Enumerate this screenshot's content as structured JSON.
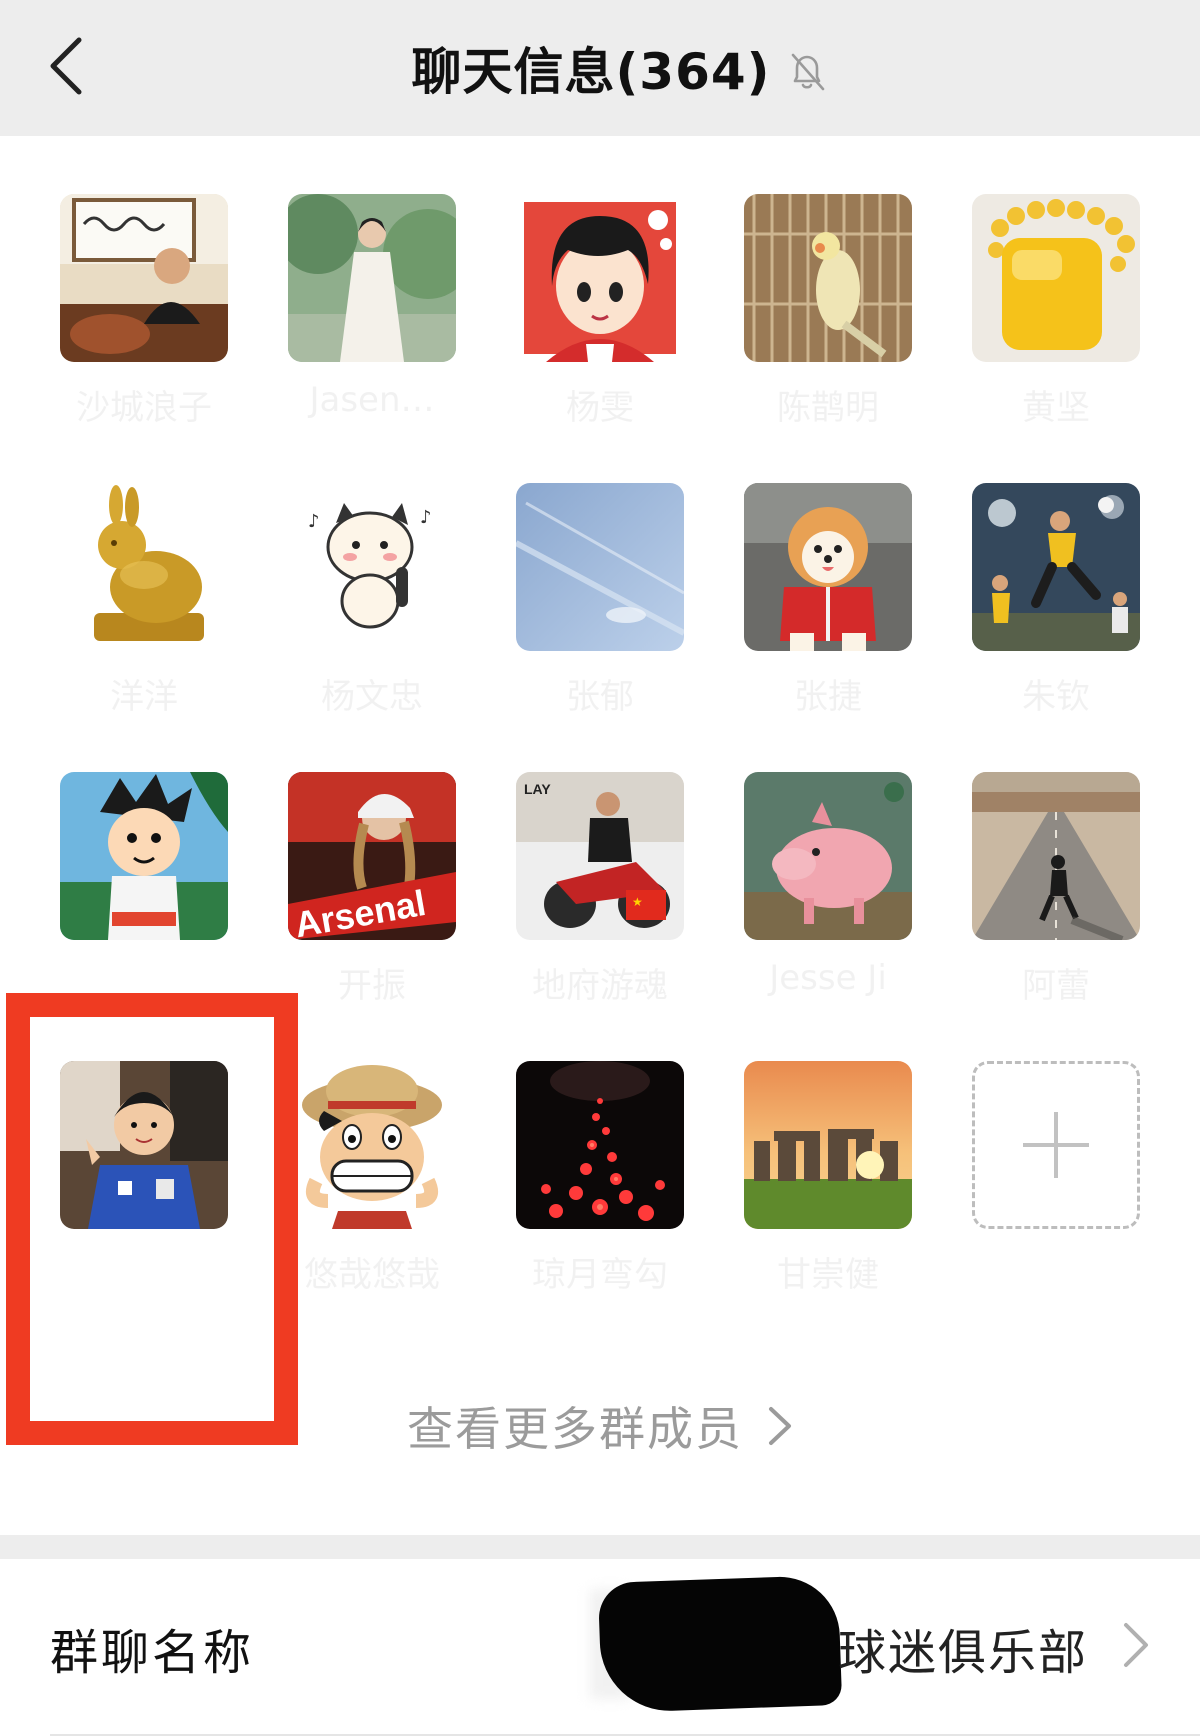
{
  "header": {
    "title": "聊天信息(364)",
    "back_icon": "chevron-left-icon",
    "mute_icon": "bell-off-icon"
  },
  "members": [
    {
      "name": "沙城浪子"
    },
    {
      "name": "Jasen…"
    },
    {
      "name": "杨雯"
    },
    {
      "name": "陈鹊明"
    },
    {
      "name": "黄坚"
    },
    {
      "name": "洋洋"
    },
    {
      "name": "杨文忠"
    },
    {
      "name": "张郁"
    },
    {
      "name": "张捷"
    },
    {
      "name": "朱钦"
    },
    {
      "name": ""
    },
    {
      "name": "开振"
    },
    {
      "name": "地府游魂"
    },
    {
      "name": "Jesse Ji"
    },
    {
      "name": "阿蕾"
    },
    {
      "name": ""
    },
    {
      "name": "悠哉悠哉"
    },
    {
      "name": "琼月弯勾"
    },
    {
      "name": "甘崇健"
    }
  ],
  "avatar_captions": {
    "arsenal": "Arsenal",
    "lay": "LAY"
  },
  "add_member": {
    "icon": "plus-icon"
  },
  "view_more": {
    "label": "查看更多群成员",
    "icon": "chevron-right-icon"
  },
  "group_name": {
    "label": "群聊名称",
    "value": "球迷俱乐部"
  },
  "colors": {
    "header_bg": "#ededed",
    "highlight": "#ef3b22",
    "muted_text": "#9b9b9b"
  }
}
